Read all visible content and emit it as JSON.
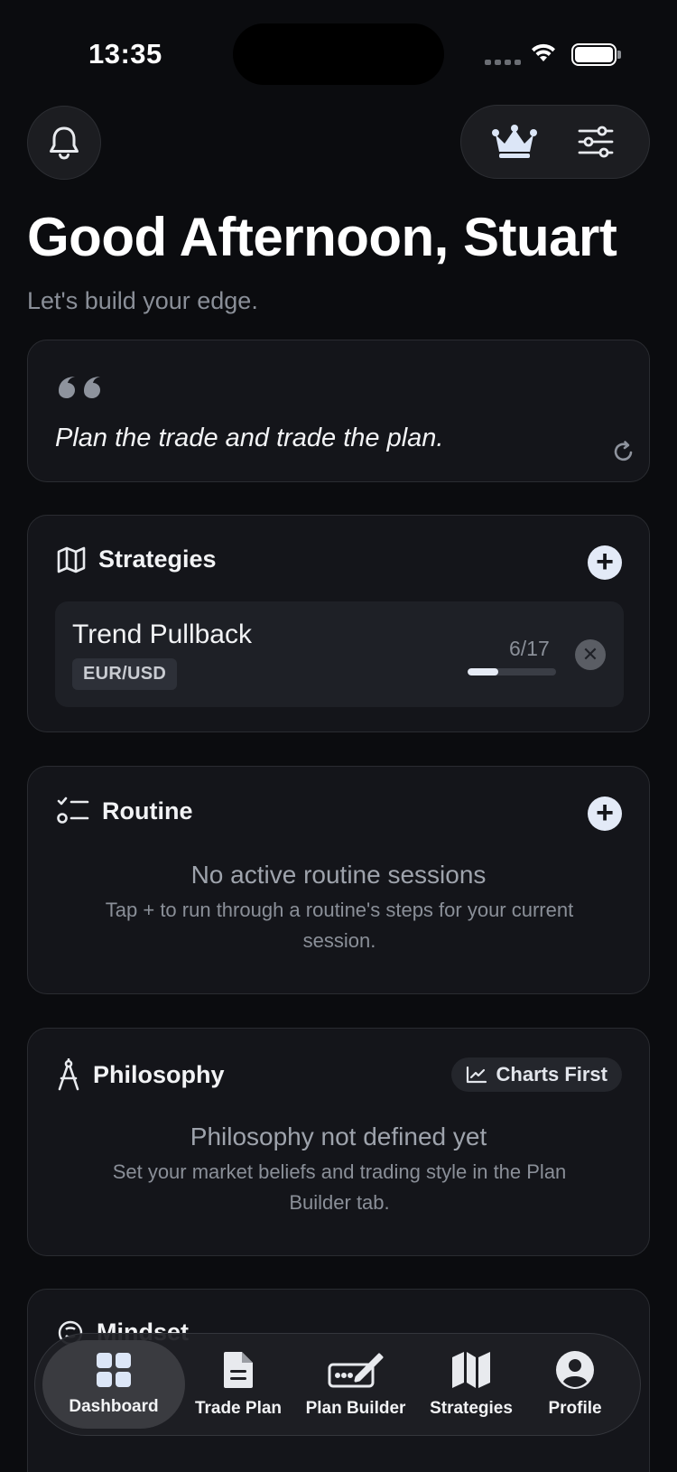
{
  "status_bar": {
    "time": "13:35"
  },
  "header": {
    "greeting": "Good Afternoon, Stuart",
    "subtitle": "Let's build your edge."
  },
  "quote": {
    "text": "Plan the trade and trade the plan."
  },
  "strategies": {
    "title": "Strategies",
    "items": [
      {
        "name": "Trend Pullback",
        "pair": "EUR/USD",
        "progress_label": "6/17",
        "progress": 0.35
      }
    ]
  },
  "routine": {
    "title": "Routine",
    "empty_title": "No active routine sessions",
    "empty_desc": "Tap + to run through a routine's steps for your current session."
  },
  "philosophy": {
    "title": "Philosophy",
    "tag": "Charts First",
    "empty_title": "Philosophy not defined yet",
    "empty_desc": "Set your market beliefs and trading style in the Plan Builder tab."
  },
  "mindset": {
    "title": "Mindset"
  },
  "tabs": [
    {
      "label": "Dashboard",
      "icon": "grid-icon",
      "active": true
    },
    {
      "label": "Trade Plan",
      "icon": "document-icon",
      "active": false
    },
    {
      "label": "Plan Builder",
      "icon": "signature-icon",
      "active": false
    },
    {
      "label": "Strategies",
      "icon": "map-icon",
      "active": false
    },
    {
      "label": "Profile",
      "icon": "person-icon",
      "active": false
    }
  ],
  "colors": {
    "background": "#0b0c0f",
    "card": "#14151a",
    "accent": "#e3eaf7",
    "muted": "#8a8f98"
  }
}
